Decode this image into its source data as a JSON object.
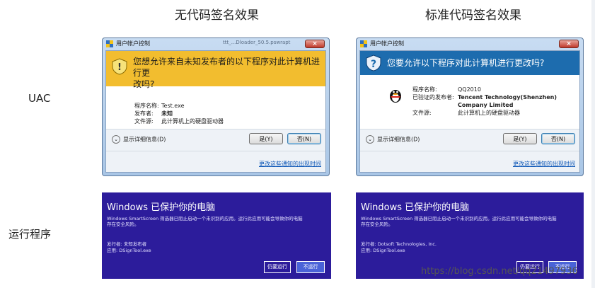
{
  "columns": {
    "unsigned_title": "无代码签名效果",
    "signed_title": "标准代码签名效果"
  },
  "rows": {
    "uac_label": "UAC",
    "run_label": "运行程序"
  },
  "uac_unsigned": {
    "window_title": "用户帐户控制",
    "background_title": "ttt_...Dloader_50.5.pswrapt",
    "close_glyph": "×",
    "banner_line1": "您想允许来自未知发布者的以下程序对此计算机进行更",
    "banner_line2": "改吗?",
    "program_name_label": "程序名称:",
    "program_name": "Test.exe",
    "publisher_label": "发布者:",
    "publisher": "未知",
    "source_label": "文件源:",
    "source": "此计算机上的硬盘驱动器",
    "details": "显示详细信息(D)",
    "yes": "是(Y)",
    "no": "否(N)",
    "link": "更改这些通知的出现时间"
  },
  "uac_signed": {
    "window_title": "用户帐户控制",
    "close_glyph": "×",
    "banner_line1": "您要允许以下程序对此计算机进行更改吗?",
    "program_name_label": "程序名称:",
    "program_name": "QQ2010",
    "publisher_label": "已验证的发布者:",
    "publisher_line1": "Tencent Technology(Shenzhen)",
    "publisher_line2": "Company Limited",
    "source_label": "文件源:",
    "source": "此计算机上的硬盘驱动器",
    "details": "显示详细信息(D)",
    "yes": "是(Y)",
    "no": "否(N)",
    "link": "更改这些通知的出现时间"
  },
  "smartscreen_unsigned": {
    "heading": "Windows 已保护你的电脑",
    "description": "Windows SmartScreen 筛选器已阻止启动一个未识别的应用。运行此应用可能会导致你的电脑存在安全风险。",
    "publisher_line": "发行者: 未知发布者",
    "app_line": "应用:    DSignTool.exe",
    "run_anyway": "仍要运行",
    "dont_run": "不运行"
  },
  "smartscreen_signed": {
    "heading": "Windows 已保护你的电脑",
    "description": "Windows SmartScreen 筛选器已阻止启动一个未识别的应用。运行此应用可能会导致你的电脑存在安全风险。",
    "publisher_line": "发行者: Dotsoft Technologies, Inc.",
    "app_line": "应用:    DSignTool.exe",
    "run_anyway": "仍要运行",
    "dont_run": "不运行"
  },
  "watermark": "https://blog.csdn.net/qq21497936",
  "colors": {
    "warning_banner": "#f2bd2f",
    "info_banner": "#1d6cae",
    "smartscreen_bg": "#2c1c9b",
    "link": "#0b55b6"
  },
  "icons": {
    "uac_shield": "uac-shield-icon",
    "qq": "qq-penguin-icon",
    "close": "close-icon",
    "expand": "chevron-down-icon"
  }
}
